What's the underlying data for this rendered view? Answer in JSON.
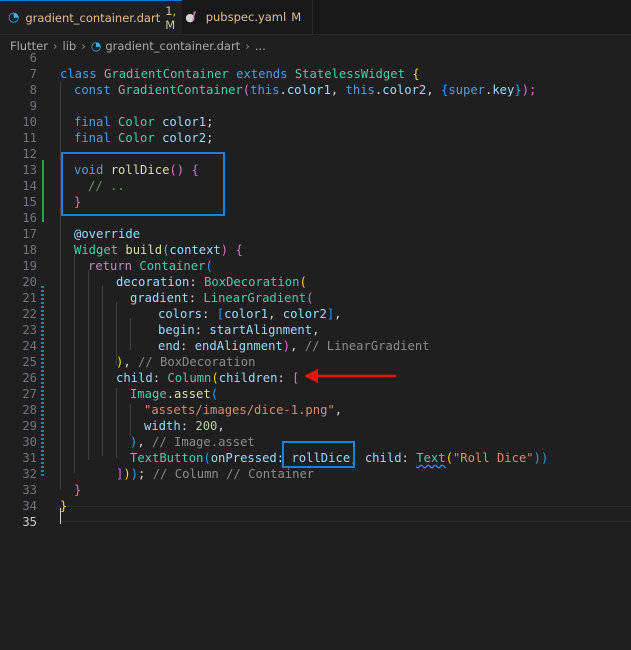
{
  "tabs": [
    {
      "label": "gradient_container.dart",
      "status": "1, M",
      "dirty": "●",
      "icon": "dart-icon"
    },
    {
      "label": "pubspec.yaml",
      "status": "M",
      "icon": "yaml-icon"
    }
  ],
  "breadcrumb": [
    "Flutter",
    "lib",
    "gradient_container.dart",
    "..."
  ],
  "line_numbers": [
    "6",
    "7",
    "8",
    "9",
    "10",
    "11",
    "12",
    "13",
    "14",
    "15",
    "16",
    "17",
    "18",
    "19",
    "20",
    "21",
    "22",
    "23",
    "24",
    "25",
    "26",
    "27",
    "28",
    "29",
    "30",
    "31",
    "32",
    "33",
    "34",
    "35"
  ],
  "code": {
    "l7": [
      "class",
      "GradientContainer",
      "extends",
      "StatelessWidget",
      "{"
    ],
    "l8": [
      "const",
      "GradientContainer",
      "(",
      "this",
      ".",
      "color1",
      ", ",
      "this",
      ".",
      "color2",
      ", ",
      "{",
      "super",
      ".",
      "key",
      "}",
      ");"
    ],
    "l10": [
      "final",
      "Color",
      "color1",
      ";"
    ],
    "l11": [
      "final",
      "Color",
      "color2",
      ";"
    ],
    "l13": [
      "void",
      "rollDice",
      "()",
      "{"
    ],
    "l14": [
      "// .."
    ],
    "l15": [
      "}"
    ],
    "l17": [
      "@override"
    ],
    "l18": [
      "Widget",
      "build",
      "(",
      "context",
      ")",
      "{"
    ],
    "l19": [
      "return",
      "Container",
      "("
    ],
    "l20": [
      "decoration",
      ":",
      "BoxDecoration",
      "("
    ],
    "l21": [
      "gradient",
      ":",
      "LinearGradient",
      "("
    ],
    "l22": [
      "colors",
      ":",
      "[",
      "color1",
      ", ",
      "color2",
      "]",
      ","
    ],
    "l23": [
      "begin",
      ":",
      "startAlignment",
      ","
    ],
    "l24": [
      "end",
      ":",
      "endAlignment",
      ")",
      ",",
      "// LinearGradient"
    ],
    "l25": [
      ")",
      ",",
      "// BoxDecoration"
    ],
    "l26": [
      "child",
      ":",
      "Column",
      "(",
      "children",
      ":",
      "["
    ],
    "l27": [
      "Image",
      ".",
      "asset",
      "("
    ],
    "l28": [
      "\"assets/images/dice-1.png\"",
      ","
    ],
    "l29": [
      "width",
      ":",
      "200",
      ","
    ],
    "l30": [
      ")",
      ",",
      "// Image.asset"
    ],
    "l31": [
      "TextButton",
      "(",
      "onPressed",
      ":",
      "rollDice",
      ",",
      "child",
      ":",
      "Text",
      "(",
      "\"Roll Dice\"",
      "))"
    ],
    "l32": [
      "]",
      ")",
      ")",
      ";",
      "// Column // Container"
    ],
    "l33": [
      "}"
    ],
    "l34": [
      "}"
    ]
  },
  "colors": {
    "box": "#1a7fe0",
    "arrow": "#e51400",
    "keyword": "#569cd6",
    "type": "#4ec9b0"
  }
}
